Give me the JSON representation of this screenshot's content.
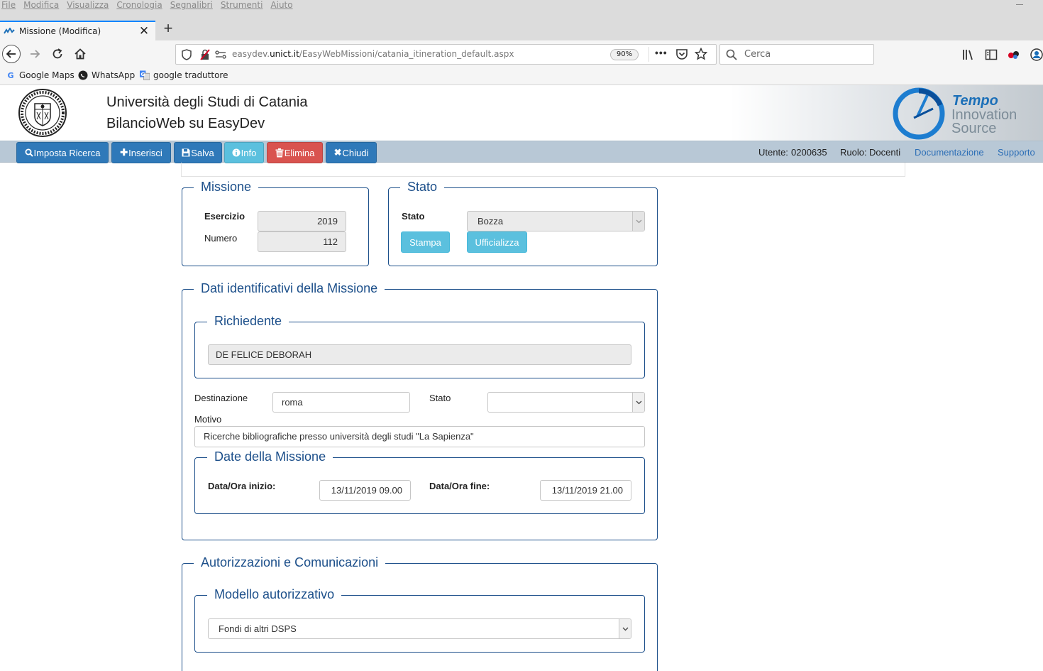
{
  "browser": {
    "menu": [
      "File",
      "Modifica",
      "Visualizza",
      "Cronologia",
      "Segnalibri",
      "Strumenti",
      "Aiuto"
    ],
    "tab_title": "Missione (Modifica)",
    "url_prefix": "easydev.",
    "url_domain": "unict.it",
    "url_path": "/EasyWebMissioni/catania_itineration_default.aspx",
    "zoom": "90%",
    "search_placeholder": "Cerca",
    "bookmarks": [
      "Google Maps",
      "WhatsApp",
      "google traduttore"
    ]
  },
  "header": {
    "title": "Università degli Studi di Catania",
    "subtitle": "BilancioWeb su EasyDev",
    "logo_line1": "Tempo",
    "logo_line2": "Innovation",
    "logo_line3": "Source"
  },
  "toolbar": {
    "buttons": [
      "Imposta Ricerca",
      "Inserisci",
      "Salva",
      "Info",
      "Elimina",
      "Chiudi"
    ],
    "utente_label": "Utente:",
    "utente_value": "0200635",
    "ruolo_label": "Ruolo:",
    "ruolo_value": "Docenti",
    "documentazione": "Documentazione",
    "supporto": "Supporto"
  },
  "missione": {
    "legend": "Missione",
    "esercizio_label": "Esercizio",
    "esercizio_value": "2019",
    "numero_label": "Numero",
    "numero_value": "112"
  },
  "stato_box": {
    "legend": "Stato",
    "stato_label": "Stato",
    "stato_value": "Bozza",
    "stampa": "Stampa",
    "ufficializza": "Ufficializza"
  },
  "dati": {
    "legend": "Dati identificativi della Missione",
    "richiedente_legend": "Richiedente",
    "richiedente_value": "DE FELICE DEBORAH",
    "destinazione_label": "Destinazione",
    "destinazione_value": "roma",
    "stato_label": "Stato",
    "stato_value": "",
    "motivo_label": "Motivo",
    "motivo_value": "Ricerche bibliografiche presso università degli studi \"La Sapienza\"",
    "date_legend": "Date della Missione",
    "inizio_label": "Data/Ora inizio:",
    "inizio_value": "13/11/2019 09.00",
    "fine_label": "Data/Ora fine:",
    "fine_value": "13/11/2019 21.00"
  },
  "autorizzazioni": {
    "legend": "Autorizzazioni e Comunicazioni",
    "modello_legend": "Modello autorizzativo",
    "modello_value": "Fondi di altri DSPS"
  },
  "colors": {
    "accent_blue": "#2f79b9",
    "light_blue": "#5bc0de",
    "danger": "#d9534f",
    "legend_blue": "#1c4f8a"
  }
}
